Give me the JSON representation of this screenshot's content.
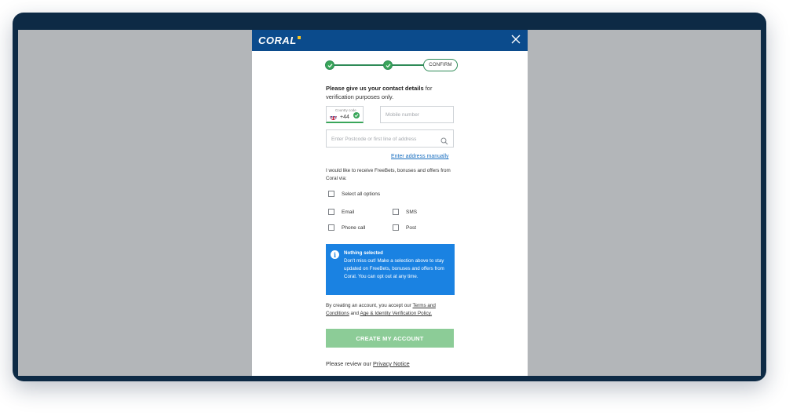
{
  "brand": {
    "name": "CORAL",
    "mark_color": "#f6c323",
    "header_color": "#0b4b8c"
  },
  "close_icon": "close-icon",
  "stepper": {
    "confirm_label": "CONFIRM",
    "step_color": "#3aa65a"
  },
  "intro": {
    "bold": "Please give us your contact details",
    "rest": " for verification purposes only."
  },
  "country_code": {
    "label": "Country code",
    "value": "+44",
    "flag": "uk-flag-icon"
  },
  "mobile": {
    "placeholder": "Mobile number"
  },
  "postcode": {
    "placeholder": "Enter Postcode or first line of address",
    "icon": "search-icon"
  },
  "manual_link": "Enter address manually",
  "optin_text": "I would like to receive FreeBets, bonuses and offers from Coral via:",
  "options": {
    "select_all": "Select all options",
    "email": "Email",
    "sms": "SMS",
    "phone": "Phone call",
    "post": "Post"
  },
  "info": {
    "title": "Nothing selected",
    "text": "Don't miss out! Make a selection above to stay updated on FreeBets, bonuses and offers from Coral. You can opt out at any time.",
    "color": "#1a82e2"
  },
  "legal": {
    "prefix": "By creating an account, you accept our ",
    "terms": "Terms and Conditions",
    "middle": " and ",
    "policy": "Age & Identity Verification Policy."
  },
  "create_button": "CREATE MY ACCOUNT",
  "privacy": {
    "prefix": "Please review our ",
    "link": "Privacy Notice"
  }
}
